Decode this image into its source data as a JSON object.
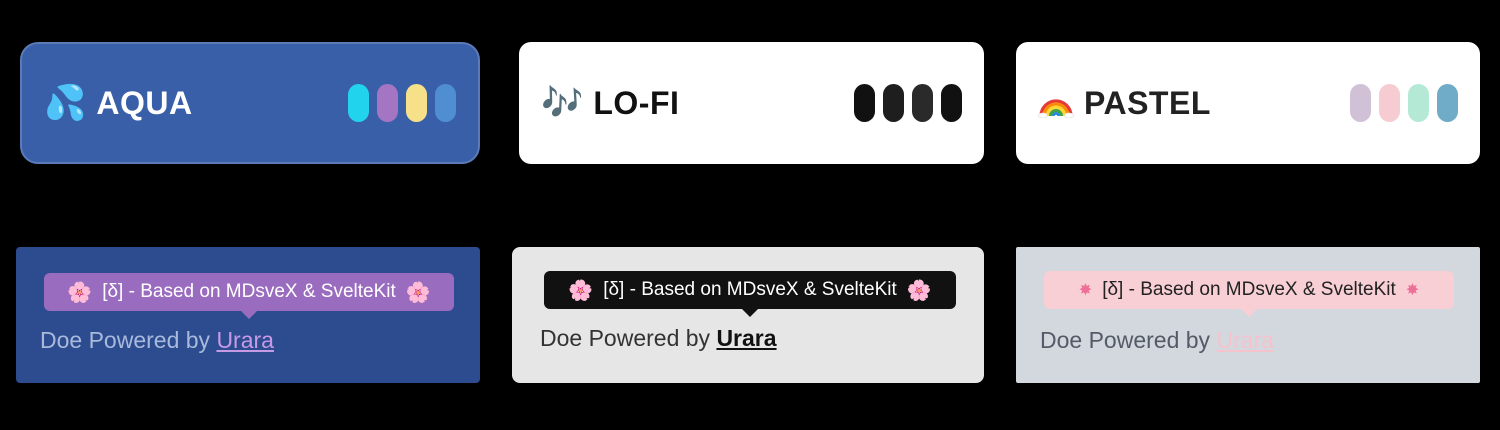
{
  "themes": [
    {
      "name": "AQUA",
      "icon": "droplets-icon",
      "emoji": "💦",
      "swatches": [
        "#22d3ee",
        "#a475c2",
        "#f7e08a",
        "#4f8fd1"
      ]
    },
    {
      "name": "LO-FI",
      "icon": "music-notes-icon",
      "emoji": "🎶",
      "swatches": [
        "#111111",
        "#1e1e1e",
        "#2a2a2a",
        "#111111"
      ]
    },
    {
      "name": "PASTEL",
      "icon": "rainbow-icon",
      "emoji": "🌈",
      "swatches": [
        "#d1c1d7",
        "#f6cbd1",
        "#b4e9d6",
        "#70acc7"
      ]
    }
  ],
  "footers": [
    {
      "tooltip": "[δ] - Based on MDsveX & SvelteKit",
      "flower": "🌸",
      "text": "Doe Powered by",
      "link": "Urara"
    },
    {
      "tooltip": "[δ] - Based on MDsveX & SvelteKit",
      "flower": "🌸",
      "text": "Doe Powered by",
      "link": "Urara"
    },
    {
      "tooltip": "[δ] - Based on MDsveX & SvelteKit",
      "flower": "✸",
      "text": "Doe Powered by",
      "link": "Urara"
    }
  ]
}
